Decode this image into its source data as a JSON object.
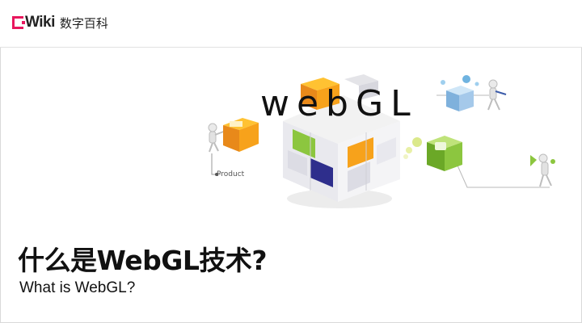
{
  "brand": {
    "logo_text": "Wiki",
    "logo_cn": "数字百科",
    "accent_color": "#e8175d"
  },
  "hero": {
    "graphic_text": "webGL",
    "product_label": "Product",
    "cube_colors": [
      "#f7a21b",
      "#8cc63f",
      "#2e2e8c",
      "#f0f0f0"
    ]
  },
  "title": {
    "main": "什么是WebGL技术?",
    "sub": "What is WebGL?"
  },
  "icons": [
    "cube-icon",
    "figure-icon",
    "orange-box-icon",
    "green-box-icon",
    "blue-bubble-icon",
    "megaphone-figure-icon"
  ]
}
